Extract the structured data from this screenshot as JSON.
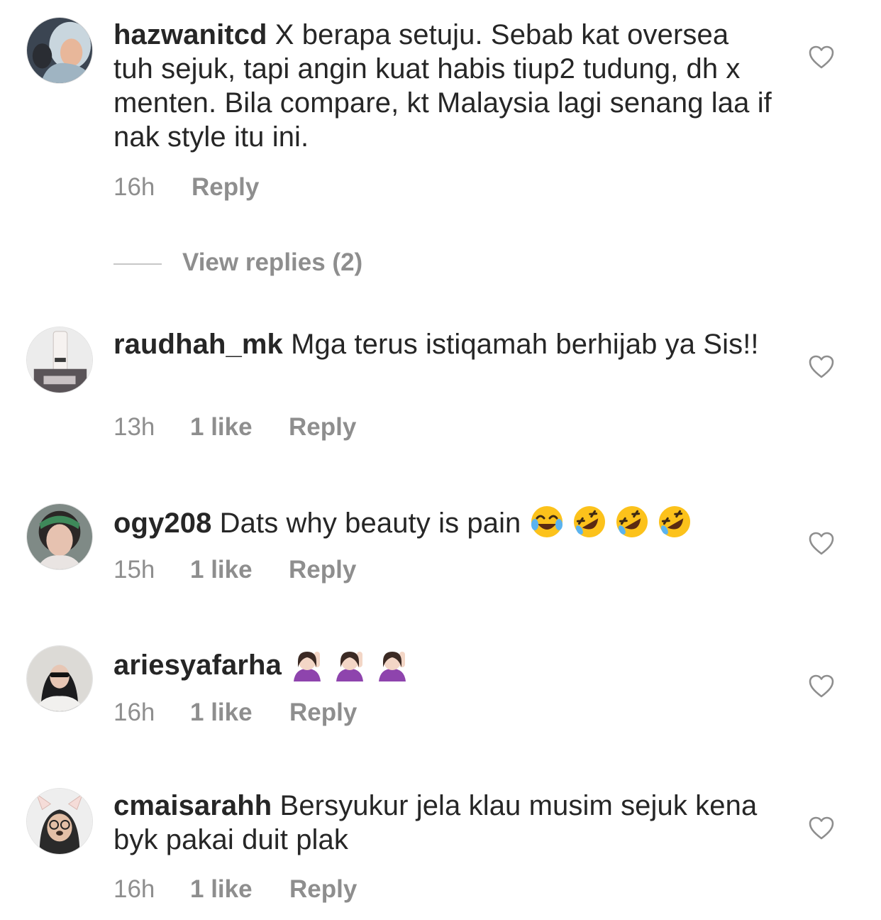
{
  "comments": [
    {
      "username": "hazwanitcd",
      "text": " X berapa setuju. Sebab kat oversea tuh sejuk, tapi angin kuat habis tiup2 tudung, dh x menten. Bila compare, kt Malaysia lagi senang laa if nak style itu ini.",
      "time": "16h",
      "likes": "",
      "reply_label": "Reply",
      "avatar_icon": "profile-photo-hijab-woman"
    },
    {
      "username": "raudhah_mk",
      "text": " Mga terus istiqamah berhijab ya Sis!!",
      "time": "13h",
      "likes": "1 like",
      "reply_label": "Reply",
      "avatar_icon": "profile-photo-cosmetic-bottle"
    },
    {
      "username": "ogy208",
      "text": " Dats why beauty is pain ",
      "emojis": [
        "face-with-tears-of-joy-emoji",
        "rolling-on-the-floor-laughing-emoji",
        "rolling-on-the-floor-laughing-emoji",
        "rolling-on-the-floor-laughing-emoji"
      ],
      "time": "15h",
      "likes": "1 like",
      "reply_label": "Reply",
      "avatar_icon": "profile-photo-woman-headband"
    },
    {
      "username": "ariesyafarha",
      "text": " ",
      "emojis": [
        "person-raising-hand-emoji",
        "person-raising-hand-emoji",
        "person-raising-hand-emoji"
      ],
      "time": "16h",
      "likes": "1 like",
      "reply_label": "Reply",
      "avatar_icon": "profile-photo-woman-sunglasses"
    },
    {
      "username": "cmaisarahh",
      "text": " Bersyukur jela klau musim sejuk kena byk pakai duit plak",
      "time": "16h",
      "likes": "1 like",
      "reply_label": "Reply",
      "avatar_icon": "profile-photo-dog-filter"
    }
  ],
  "view_replies": {
    "label": "View replies (2)"
  },
  "colors": {
    "text": "#262626",
    "muted": "#8e8e8e",
    "divider": "#c7c7c7"
  }
}
